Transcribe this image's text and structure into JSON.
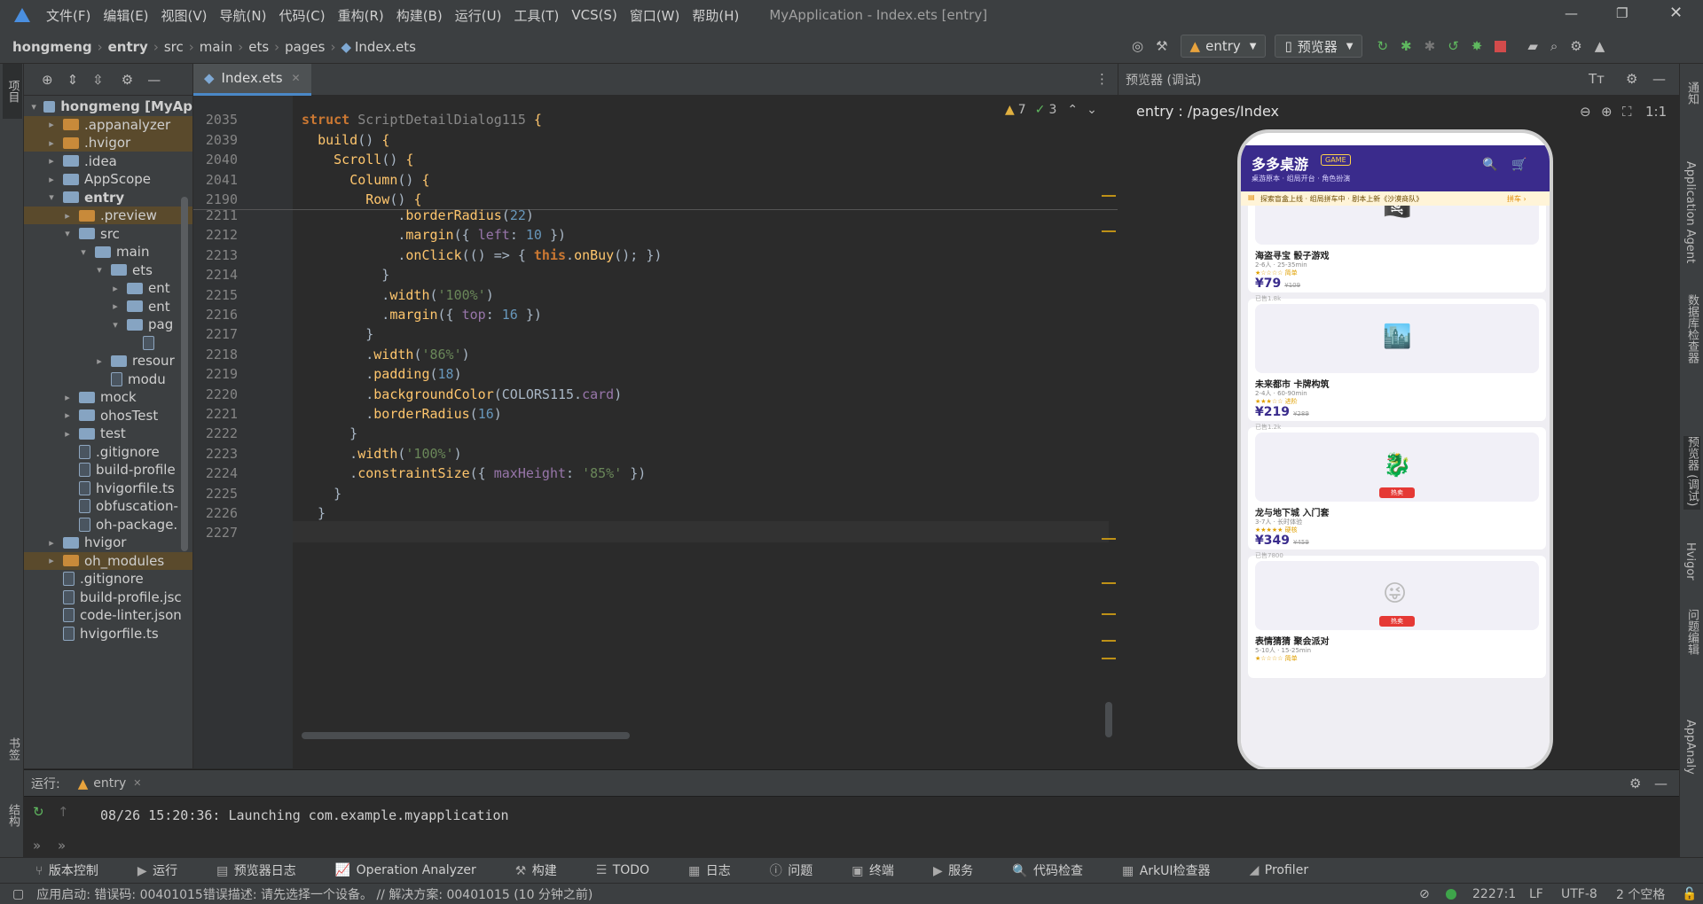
{
  "titlebar": {
    "menus": [
      "文件(F)",
      "编辑(E)",
      "视图(V)",
      "导航(N)",
      "代码(C)",
      "重构(R)",
      "构建(B)",
      "运行(U)",
      "工具(T)",
      "VCS(S)",
      "窗口(W)",
      "帮助(H)"
    ],
    "title": "MyApplication - Index.ets [entry]"
  },
  "breadcrumb": [
    "hongmeng",
    "entry",
    "src",
    "main",
    "ets",
    "pages",
    "Index.ets"
  ],
  "toolbar": {
    "config": "entry",
    "device": "预览器"
  },
  "left_strip": {
    "project": "项目",
    "bookmarks": "书签",
    "structure": "结构"
  },
  "project_tree": [
    {
      "label": "hongmeng [MyAp",
      "depth": 0,
      "arrow": "▾",
      "kind": "folder",
      "bold": true
    },
    {
      "label": ".appanalyzer",
      "depth": 1,
      "arrow": "▸",
      "kind": "folder-orange",
      "hl": true
    },
    {
      "label": ".hvigor",
      "depth": 1,
      "arrow": "▸",
      "kind": "folder-orange",
      "hl": true
    },
    {
      "label": ".idea",
      "depth": 1,
      "arrow": "▸",
      "kind": "folder"
    },
    {
      "label": "AppScope",
      "depth": 1,
      "arrow": "▸",
      "kind": "folder"
    },
    {
      "label": "entry",
      "depth": 1,
      "arrow": "▾",
      "kind": "folder",
      "bold": true
    },
    {
      "label": ".preview",
      "depth": 2,
      "arrow": "▸",
      "kind": "folder-orange",
      "hl": true
    },
    {
      "label": "src",
      "depth": 2,
      "arrow": "▾",
      "kind": "folder"
    },
    {
      "label": "main",
      "depth": 3,
      "arrow": "▾",
      "kind": "folder"
    },
    {
      "label": "ets",
      "depth": 4,
      "arrow": "▾",
      "kind": "folder"
    },
    {
      "label": "ent",
      "depth": 5,
      "arrow": "▸",
      "kind": "folder"
    },
    {
      "label": "ent",
      "depth": 5,
      "arrow": "▸",
      "kind": "folder"
    },
    {
      "label": "pag",
      "depth": 5,
      "arrow": "▾",
      "kind": "folder"
    },
    {
      "label": "",
      "depth": 6,
      "arrow": "",
      "kind": "file"
    },
    {
      "label": "resour",
      "depth": 4,
      "arrow": "▸",
      "kind": "folder"
    },
    {
      "label": "modu",
      "depth": 4,
      "arrow": "",
      "kind": "file"
    },
    {
      "label": "mock",
      "depth": 2,
      "arrow": "▸",
      "kind": "folder"
    },
    {
      "label": "ohosTest",
      "depth": 2,
      "arrow": "▸",
      "kind": "folder"
    },
    {
      "label": "test",
      "depth": 2,
      "arrow": "▸",
      "kind": "folder"
    },
    {
      "label": ".gitignore",
      "depth": 2,
      "arrow": "",
      "kind": "file"
    },
    {
      "label": "build-profile",
      "depth": 2,
      "arrow": "",
      "kind": "file"
    },
    {
      "label": "hvigorfile.ts",
      "depth": 2,
      "arrow": "",
      "kind": "file"
    },
    {
      "label": "obfuscation-",
      "depth": 2,
      "arrow": "",
      "kind": "file"
    },
    {
      "label": "oh-package.",
      "depth": 2,
      "arrow": "",
      "kind": "file"
    },
    {
      "label": "hvigor",
      "depth": 1,
      "arrow": "▸",
      "kind": "folder"
    },
    {
      "label": "oh_modules",
      "depth": 1,
      "arrow": "▸",
      "kind": "folder-orange",
      "hl": true
    },
    {
      "label": ".gitignore",
      "depth": 1,
      "arrow": "",
      "kind": "file"
    },
    {
      "label": "build-profile.jsc",
      "depth": 1,
      "arrow": "",
      "kind": "file"
    },
    {
      "label": "code-linter.json",
      "depth": 1,
      "arrow": "",
      "kind": "file"
    },
    {
      "label": "hvigorfile.ts",
      "depth": 1,
      "arrow": "",
      "kind": "file"
    }
  ],
  "editor": {
    "tab": "Index.ets",
    "warnings": "7",
    "checks": "3",
    "sticky": [
      {
        "ln": "2035",
        "html": "<span class='kw2'>struct</span> <span class='cls' style='color:#888'>ScriptDetailDialog115</span> <span class='fn'>{</span>"
      },
      {
        "ln": "2039",
        "html": "  <span class='fn'>build</span>() <span class='fn'>{</span>"
      },
      {
        "ln": "2040",
        "html": "    <span class='fn'>Scroll</span>() <span class='fn'>{</span>"
      },
      {
        "ln": "2041",
        "html": "      <span class='fn'>Column</span>() <span class='fn'>{</span>"
      },
      {
        "ln": "2190",
        "html": "        <span class='fn'>Row</span>() <span class='fn'>{</span>"
      }
    ],
    "lines": [
      {
        "ln": "2211",
        "html": "            .<span class='fn'>borderRadius</span>(<span class='num'>22</span>)"
      },
      {
        "ln": "2212",
        "html": "            .<span class='fn'>margin</span>({ <span class='prop'>left</span>: <span class='num'>10</span> })"
      },
      {
        "ln": "2213",
        "html": "            .<span class='fn'>onClick</span>(() => { <span class='kw2'>this</span>.<span class='fn'>onBuy</span>(); })"
      },
      {
        "ln": "2214",
        "html": "          }"
      },
      {
        "ln": "2215",
        "html": "          .<span class='fn'>width</span>(<span class='str'>'100%'</span>)"
      },
      {
        "ln": "2216",
        "html": "          .<span class='fn'>margin</span>({ <span class='prop'>top</span>: <span class='num'>16</span> })"
      },
      {
        "ln": "2217",
        "html": "        }"
      },
      {
        "ln": "2218",
        "html": "        .<span class='fn'>width</span>(<span class='str'>'86%'</span>)"
      },
      {
        "ln": "2219",
        "html": "        .<span class='fn'>padding</span>(<span class='num'>18</span>)"
      },
      {
        "ln": "2220",
        "html": "        .<span class='fn'>backgroundColor</span>(COLORS115.<span class='prop'>card</span>)"
      },
      {
        "ln": "2221",
        "html": "        .<span class='fn'>borderRadius</span>(<span class='num'>16</span>)"
      },
      {
        "ln": "2222",
        "html": "      }"
      },
      {
        "ln": "2223",
        "html": "      .<span class='fn'>width</span>(<span class='str'>'100%'</span>)"
      },
      {
        "ln": "2224",
        "html": "      .<span class='fn'>constraintSize</span>({ <span class='prop'>maxHeight</span>: <span class='str'>'85%'</span> })"
      },
      {
        "ln": "2225",
        "html": "    }"
      },
      {
        "ln": "2226",
        "html": "  }"
      },
      {
        "ln": "2227",
        "html": ""
      }
    ]
  },
  "preview": {
    "header": "预览器 (调试)",
    "route": "entry : /pages/Index",
    "app_title": "多多桌游",
    "app_badge": "GAME",
    "app_subtitle": "桌游原本 · 组局开台 · 角色扮演",
    "notice": "探索盲盒上线 · 组局拼车中 · 剧本上新《沙漠商队》",
    "notice_action": "拼车 ›",
    "games": [
      {
        "name": "海盗寻宝 骰子游戏",
        "meta": "2-6人 · 25-35min",
        "stars": "★☆☆☆☆ 简单",
        "price": "¥79",
        "old": "¥109",
        "sold": "已售1.8k",
        "emoji": "🏴‍☠️",
        "hot": false
      },
      {
        "name": "未来都市 卡牌构筑",
        "meta": "2-4人 · 60-90min",
        "stars": "★★★☆☆ 进阶",
        "price": "¥219",
        "old": "¥289",
        "sold": "已售1.2k",
        "emoji": "🏙️",
        "hot": false
      },
      {
        "name": "龙与地下城 入门套",
        "meta": "3-7人 · 长时体验",
        "stars": "★★★★★ 硬核",
        "price": "¥349",
        "old": "¥459",
        "sold": "已售7800",
        "emoji": "🐉",
        "hot": true
      },
      {
        "name": "表情猜猜 聚会派对",
        "meta": "5-10人 · 15-25min",
        "stars": "★☆☆☆☆ 简单",
        "price": "",
        "old": "",
        "sold": "",
        "emoji": "😜",
        "hot": true
      }
    ],
    "hot_label": "热卖"
  },
  "right_strip": [
    "通知",
    "Application Agent",
    "数据库检查器",
    "预览器 (调试)",
    "Hvigor",
    "问题编辑",
    "AppAnaly"
  ],
  "run_panel": {
    "label": "运行:",
    "tab": "entry",
    "log": "08/26 15:20:36: Launching com.example.myapplication"
  },
  "tool_windows": [
    "版本控制",
    "运行",
    "预览器日志",
    "Operation Analyzer",
    "构建",
    "TODO",
    "日志",
    "问题",
    "终端",
    "服务",
    "代码检查",
    "ArkUI检查器",
    "Profiler"
  ],
  "status": {
    "message": "应用启动: 错误码: 00401015错误描述: 请先选择一个设备。 // 解决方案: 00401015 (10 分钟之前)",
    "position": "2227:1",
    "line_sep": "LF",
    "encoding": "UTF-8",
    "indent": "2 个空格"
  }
}
